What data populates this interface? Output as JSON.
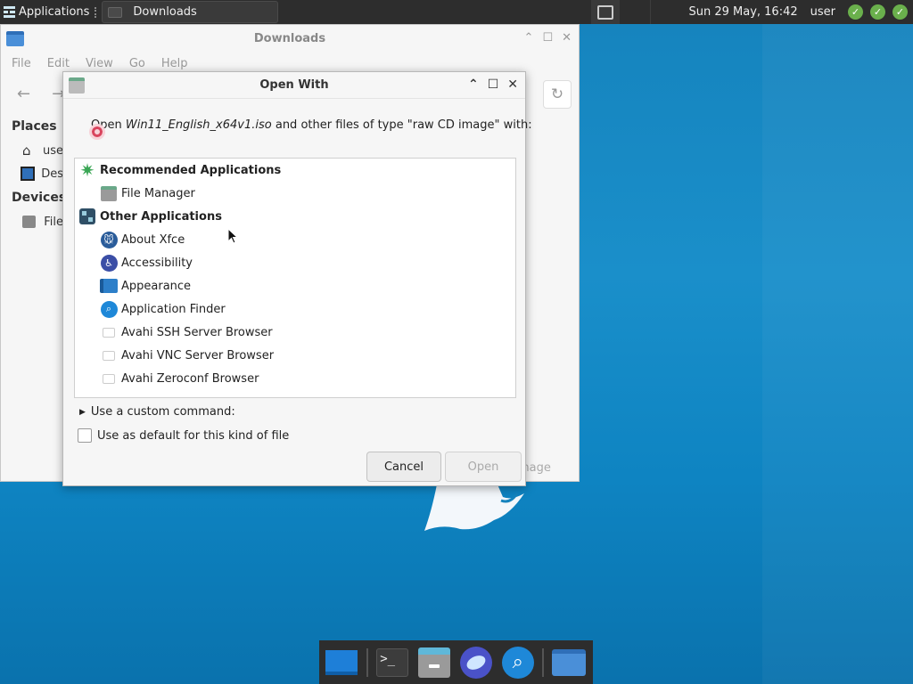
{
  "top_panel": {
    "applications_label": "Applications",
    "task_label": "Downloads",
    "clock": "Sun 29 May, 16:42",
    "user": "user"
  },
  "file_manager": {
    "title": "Downloads",
    "menu": [
      "File",
      "Edit",
      "View",
      "Go",
      "Help"
    ],
    "sidebar": {
      "places_header": "Places",
      "place_items": [
        "use",
        "Des"
      ],
      "devices_header": "Devices",
      "device_items": [
        "File"
      ]
    },
    "partial_button": "mage"
  },
  "dialog": {
    "title": "Open With",
    "prompt_prefix": "Open ",
    "file_name": "Win11_English_x64v1.iso",
    "prompt_suffix": " and other files of type \"raw CD image\" with:",
    "recommended_header": "Recommended Applications",
    "recommended": [
      "File Manager"
    ],
    "other_header": "Other Applications",
    "other": [
      "About Xfce",
      "Accessibility",
      "Appearance",
      "Application Finder",
      "Avahi SSH Server Browser",
      "Avahi VNC Server Browser",
      "Avahi Zeroconf Browser"
    ],
    "custom_command_label": "Use a custom command:",
    "default_checkbox_label": "Use as default for this kind of file",
    "cancel_label": "Cancel",
    "open_label": "Open"
  },
  "colors": {
    "desktop": "#1583bd",
    "panel": "#2d2d2d",
    "status_ok": "#6ab04c",
    "doc_icon": "#d9445d"
  }
}
